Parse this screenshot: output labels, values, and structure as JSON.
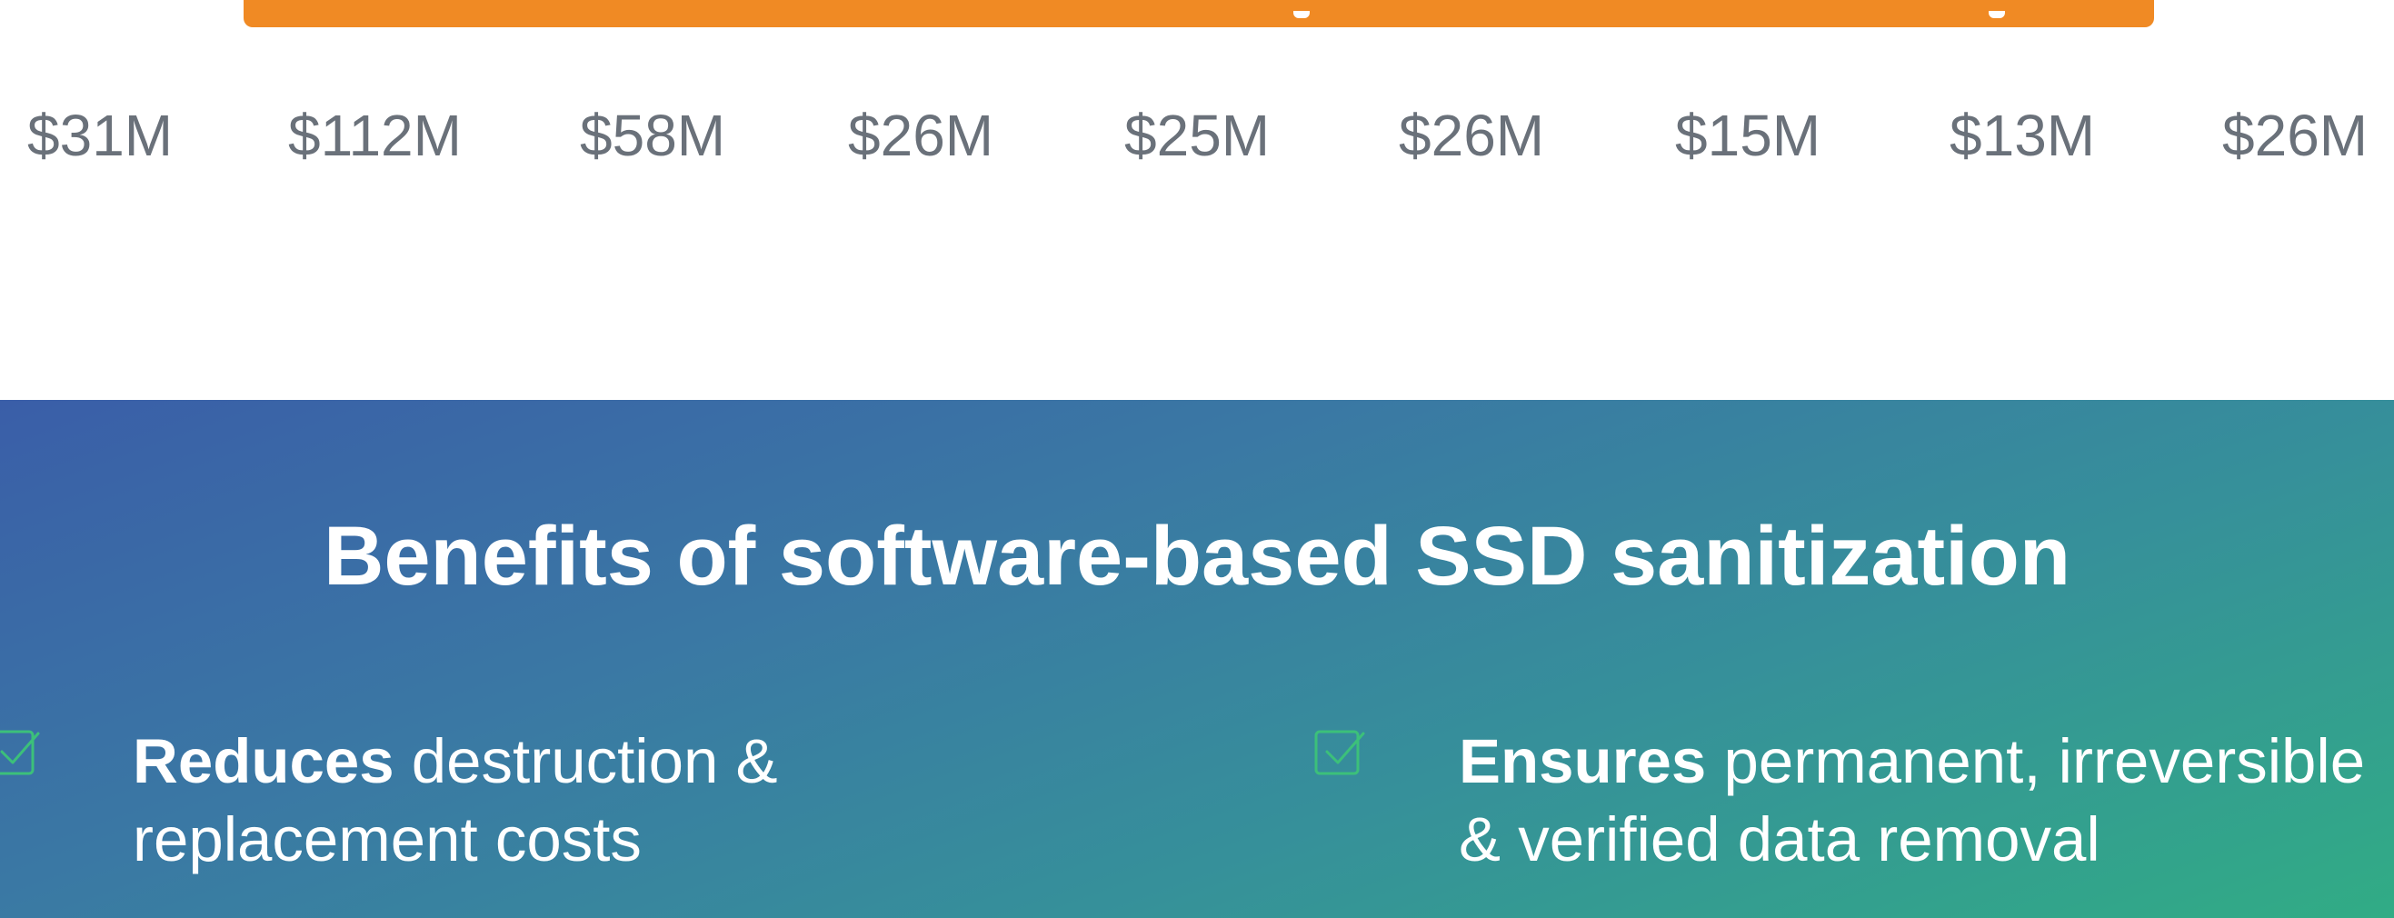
{
  "top_banner": {
    "color": "#f08a24"
  },
  "amounts": [
    "$31M",
    "$112M",
    "$58M",
    "$26M",
    "$25M",
    "$26M",
    "$15M",
    "$13M",
    "$26M"
  ],
  "benefits": {
    "title": "Benefits of software-based SSD sanitization",
    "gradient_colors": [
      "#3a5ea8",
      "#31ac85"
    ],
    "items": [
      {
        "icon": "checkbox-check-icon",
        "bold": "Reduces",
        "line1_rest": " destruction &",
        "line2": "replacement costs"
      },
      {
        "icon": "checkbox-check-icon",
        "bold": "Ensures",
        "line1_rest": " permanent, irreversible",
        "line2": "& verified data removal"
      }
    ]
  }
}
